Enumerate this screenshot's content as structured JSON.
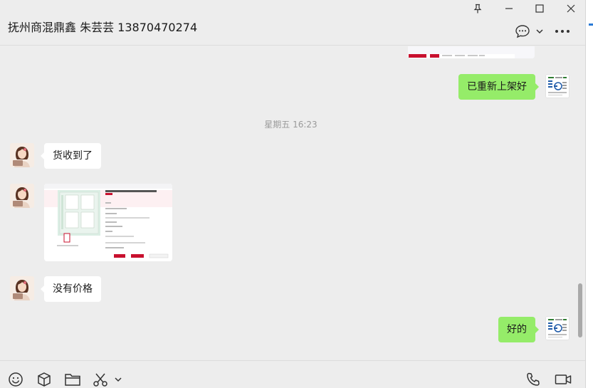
{
  "window": {
    "title": "抚州商混鼎鑫 朱芸芸 13870470274"
  },
  "window_controls": [
    "pin-icon",
    "minimize-icon",
    "maximize-icon",
    "close-icon"
  ],
  "header_actions": [
    "chat-bubble-icon",
    "chevron-down-icon",
    "more-icon"
  ],
  "messages": [
    {
      "type": "image",
      "direction": "out",
      "desc": "partial-product-screenshot"
    },
    {
      "type": "text",
      "direction": "out",
      "text": "已重新上架好"
    },
    {
      "type": "time",
      "text": "星期五 16:23"
    },
    {
      "type": "text",
      "direction": "in",
      "text": "货收到了"
    },
    {
      "type": "image",
      "direction": "in",
      "desc": "product-listing-screenshot"
    },
    {
      "type": "text",
      "direction": "in",
      "text": "没有价格"
    },
    {
      "type": "text",
      "direction": "out",
      "text": "好的"
    }
  ],
  "toolbar": {
    "left_icons": [
      "emoji-icon",
      "box-icon",
      "folder-icon",
      "scissors-icon",
      "chevron-down-icon"
    ],
    "right_icons": [
      "phone-icon",
      "video-icon"
    ]
  },
  "colors": {
    "background": "#ededed",
    "bubble_out": "#95ec69",
    "bubble_in": "#ffffff",
    "timestamp": "#9a9a9a"
  }
}
